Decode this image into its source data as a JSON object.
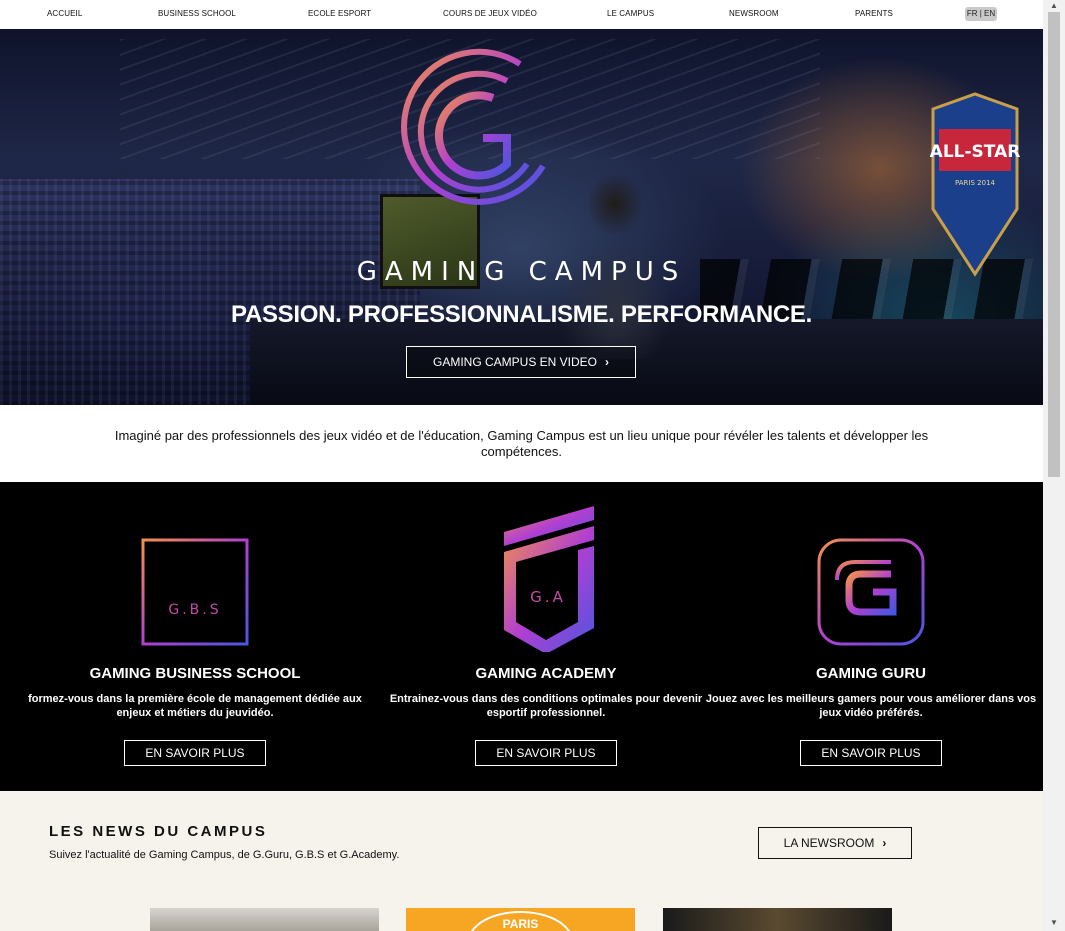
{
  "nav": {
    "items": [
      "ACCUEIL",
      "BUSINESS SCHOOL",
      "ECOLE ESPORT",
      "COURS DE JEUX VIDÉO",
      "LE CAMPUS",
      "NEWSROOM",
      "PARENTS"
    ],
    "lang": "FR | EN"
  },
  "hero": {
    "title": "GAMING CAMPUS",
    "tagline": "PASSION. PROFESSIONNALISME. PERFORMANCE.",
    "button": "GAMING CAMPUS EN VIDEO",
    "logo_colors": [
      "#f2914a",
      "#b23fd1",
      "#4a56e0"
    ],
    "badge_text": "ALL-STAR",
    "badge_sub": "PARIS 2014"
  },
  "intro": "Imaginé par des professionnels des jeux vidéo et de l'éducation, Gaming Campus est un lieu unique pour révéler les talents et développer les compétences.",
  "schools": [
    {
      "logo_text": "G.B.S",
      "name": "GAMING BUSINESS SCHOOL",
      "desc": "formez-vous dans la première école de management dédiée aux enjeux et métiers du jeuvidéo.",
      "button": "EN SAVOIR PLUS"
    },
    {
      "logo_text": "G.A",
      "name": "GAMING ACADEMY",
      "desc": "Entrainez-vous dans des conditions optimales pour devenir esportif professionnel.",
      "button": "EN SAVOIR PLUS"
    },
    {
      "logo_text": "G",
      "name": "GAMING GURU",
      "desc": "Jouez avec les meilleurs gamers pour vous améliorer dans vos jeux vidéo préférés.",
      "button": "EN SAVOIR PLUS"
    }
  ],
  "news": {
    "title": "LES NEWS DU CAMPUS",
    "subtitle": "Suivez l'actualité de Gaming Campus, de G.Guru, G.B.S et G.Academy.",
    "button": "LA NEWSROOM",
    "thumb2_text": "PARIS"
  }
}
